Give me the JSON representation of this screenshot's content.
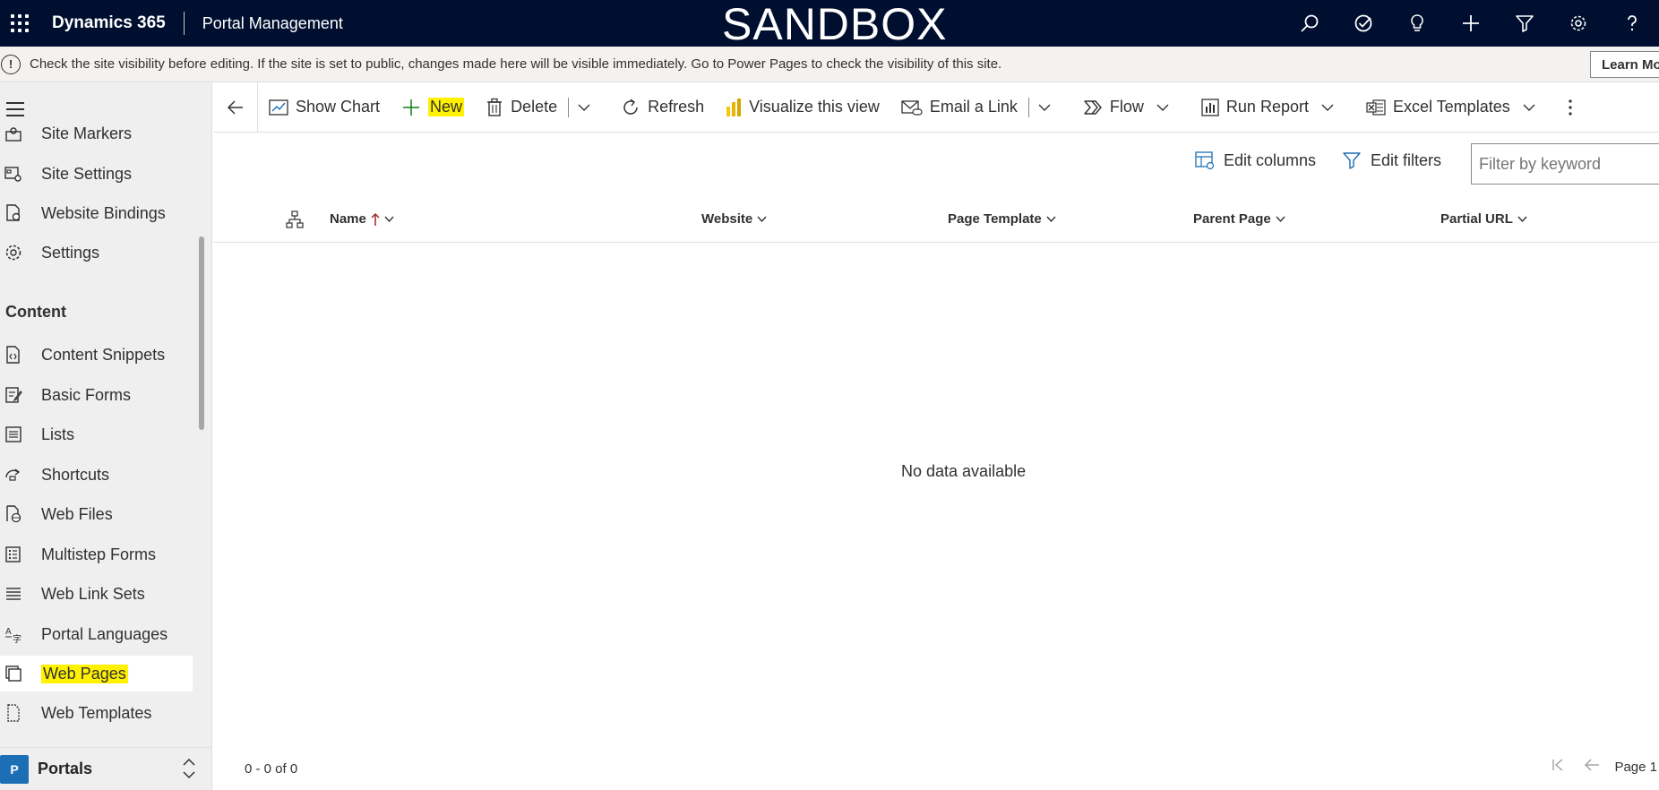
{
  "topbar": {
    "app_name": "Dynamics 365",
    "module": "Portal Management",
    "environment": "SANDBOX"
  },
  "notice": {
    "text": "Check the site visibility before editing. If the site is set to public, changes made here will be visible immediately. Go to Power Pages to check the visibility of this site.",
    "button": "Learn More"
  },
  "sidebar": {
    "items_top": [
      {
        "label": "Site Markers",
        "icon": "site-markers-icon"
      },
      {
        "label": "Site Settings",
        "icon": "site-settings-icon"
      },
      {
        "label": "Website Bindings",
        "icon": "website-bindings-icon"
      },
      {
        "label": "Settings",
        "icon": "gear-icon"
      }
    ],
    "group_title": "Content",
    "items_content": [
      {
        "label": "Content Snippets",
        "icon": "content-snippets-icon"
      },
      {
        "label": "Basic Forms",
        "icon": "basic-forms-icon"
      },
      {
        "label": "Lists",
        "icon": "list-icon"
      },
      {
        "label": "Shortcuts",
        "icon": "shortcut-icon"
      },
      {
        "label": "Web Files",
        "icon": "web-files-icon"
      },
      {
        "label": "Multistep Forms",
        "icon": "multistep-forms-icon"
      },
      {
        "label": "Web Link Sets",
        "icon": "web-link-sets-icon"
      },
      {
        "label": "Portal Languages",
        "icon": "language-icon"
      },
      {
        "label": "Web Pages",
        "icon": "web-pages-icon"
      },
      {
        "label": "Web Templates",
        "icon": "web-templates-icon"
      }
    ],
    "area": {
      "badge": "P",
      "name": "Portals"
    }
  },
  "commands": {
    "show_chart": "Show Chart",
    "new": "New",
    "delete": "Delete",
    "refresh": "Refresh",
    "visualize": "Visualize this view",
    "email_link": "Email a Link",
    "flow": "Flow",
    "run_report": "Run Report",
    "excel_templates": "Excel Templates"
  },
  "grid": {
    "edit_columns": "Edit columns",
    "edit_filters": "Edit filters",
    "filter_placeholder": "Filter by keyword",
    "columns": [
      "Name",
      "Website",
      "Page Template",
      "Parent Page",
      "Partial URL"
    ],
    "empty_message": "No data available",
    "record_count": "0 - 0 of 0",
    "page_label": "Page 1"
  },
  "colors": {
    "topbar": "#000f2f",
    "highlight": "#fff100",
    "accent": "#1d6fb5"
  }
}
